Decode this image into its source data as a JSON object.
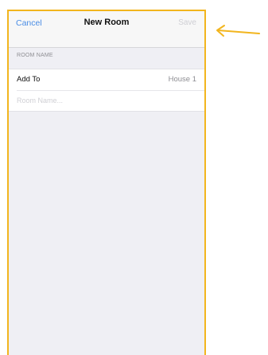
{
  "navbar": {
    "cancel_label": "Cancel",
    "title": "New Room",
    "save_label": "Save"
  },
  "section": {
    "header": "ROOM NAME"
  },
  "rows": {
    "add_to_label": "Add To",
    "add_to_value": "House 1",
    "room_name_placeholder": "Room Name...",
    "room_name_value": ""
  },
  "annotation": {
    "arrow_icon": "arrow-left-icon",
    "arrow_color": "#f2b51e"
  },
  "colors": {
    "frame": "#f2b51e",
    "accent": "#4a8de5",
    "disabled": "#cfcfd4"
  }
}
